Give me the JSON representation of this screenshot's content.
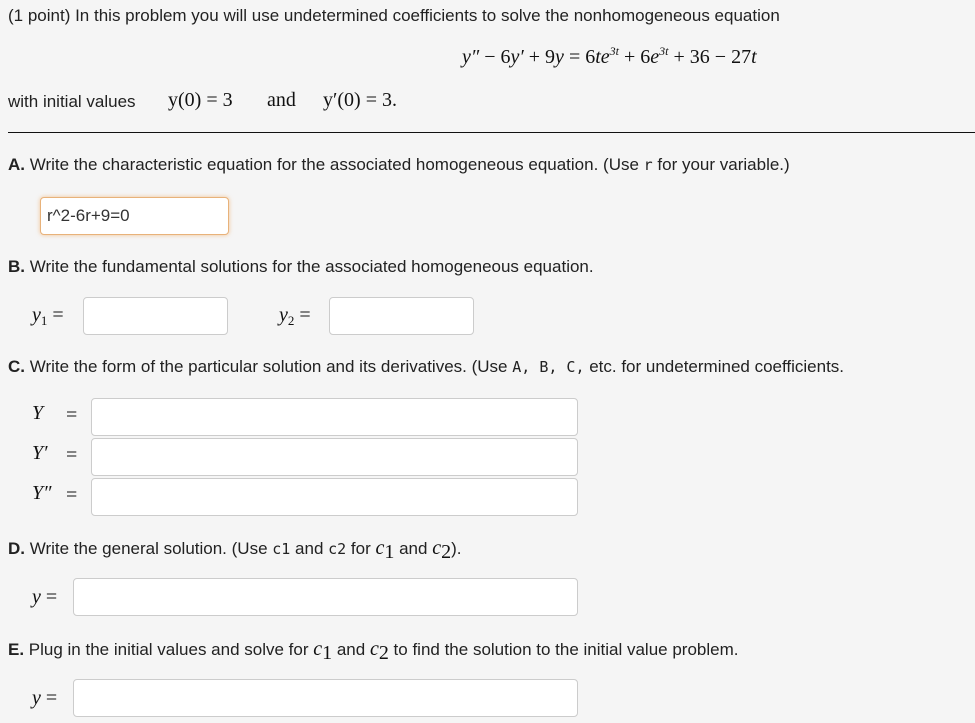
{
  "intro": {
    "text": "(1 point) In this problem you will use undetermined coefficients to solve the nonhomogeneous equation",
    "equation": {
      "lhs_y2": "y″",
      "minus1": " − 6",
      "y1": "y′",
      "plus1": " + 9",
      "y": "y",
      "eq": " = 6",
      "t1": "te",
      "exp1": "3t",
      "plus2": " + 6",
      "e2": "e",
      "exp2": "3t",
      "rest": " + 36 − 27",
      "t2": "t"
    },
    "initial_label": "with initial values",
    "ic1": "y(0) = 3",
    "and_word": "and",
    "ic2": "y′(0) = 3."
  },
  "partA": {
    "letter": "A.",
    "text_before": " Write the characteristic equation for the associated homogeneous equation. (Use ",
    "var": "r",
    "text_after": " for your variable.)",
    "answer_value": "r^2-6r+9=0"
  },
  "partB": {
    "letter": "B.",
    "text": " Write the fundamental solutions for the associated homogeneous equation.",
    "y1_label": "y",
    "y1_sub": "1",
    "y2_label": "y",
    "y2_sub": "2",
    "equals": "=",
    "y1_value": "",
    "y2_value": ""
  },
  "partC": {
    "letter": "C.",
    "text_before": " Write the form of the particular solution and its derivatives. (Use ",
    "coeffs": "A, B, C,",
    "text_after": " etc. for undetermined coefficients.",
    "Y_label": "Y",
    "Yp_label": "Y′",
    "Ypp_label": "Y″",
    "equals": "=",
    "Y_value": "",
    "Yp_value": "",
    "Ypp_value": ""
  },
  "partD": {
    "letter": "D.",
    "text1": " Write the general solution. (Use ",
    "code1": "c1",
    "text2": " and ",
    "code2": "c2",
    "text3": " for ",
    "c1": "c",
    "c1_sub": "1",
    "text4": " and ",
    "c2": "c",
    "c2_sub": "2",
    "text5": ").",
    "y_label": "y",
    "equals": "=",
    "y_value": ""
  },
  "partE": {
    "letter": "E.",
    "text1": " Plug in the initial values and solve for ",
    "c1": "c",
    "c1_sub": "1",
    "text2": " and ",
    "c2": "c",
    "c2_sub": "2",
    "text3": " to find the solution to the initial value problem.",
    "y_label": "y",
    "equals": "=",
    "y_value": ""
  }
}
